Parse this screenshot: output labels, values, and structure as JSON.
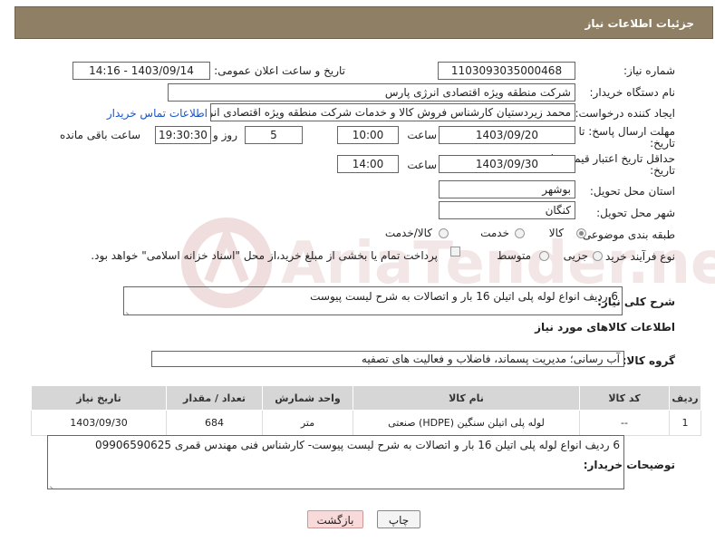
{
  "header": {
    "title": "جزئیات اطلاعات نیاز"
  },
  "form": {
    "need_number_label": "شماره نیاز:",
    "need_number": "1103093035000468",
    "announce_label": "تاریخ و ساعت اعلان عمومی:",
    "announce_value": "1403/09/14 - 14:16",
    "buyer_label": "نام دستگاه خریدار:",
    "buyer_value": "شرکت منطقه ویژه اقتصادی انرژی پارس",
    "creator_label": "ایجاد کننده درخواست:",
    "creator_value": "محمد زیردستیان کارشناس فروش کالا و خدمات شرکت منطقه ویژه اقتصادی انرژی",
    "contact_link": "اطلاعات تماس خریدار",
    "deadline_label_1": "مهلت ارسال پاسخ: تا",
    "deadline_label_2": "تاریخ:",
    "deadline_date": "1403/09/20",
    "time_label": "ساعت",
    "deadline_time": "10:00",
    "days_value": "5",
    "days_label": "روز و",
    "remaining_time": "19:30:30",
    "remaining_label": "ساعت باقی مانده",
    "validity_label_1": "حداقل تاریخ اعتبار قیمت: تا",
    "validity_label_2": "تاریخ:",
    "validity_date": "1403/09/30",
    "validity_time": "14:00",
    "province_label": "استان محل تحویل:",
    "province_value": "بوشهر",
    "city_label": "شهر محل تحویل:",
    "city_value": "کنگان",
    "category_label": "طبقه بندی موضوعی:",
    "category_options": [
      "کالا",
      "خدمت",
      "کالا/خدمت"
    ],
    "category_selected": "کالا",
    "process_label": "نوع فرآیند خرید :",
    "process_options": [
      "جزیی",
      "متوسط"
    ],
    "payment_note": "پرداخت تمام یا بخشی از مبلغ خرید،از محل \"اسناد خزانه اسلامی\" خواهد بود."
  },
  "description": {
    "label": "شرح کلی نیاز:",
    "value": "6 ردیف انواع لوله پلی اتیلن 16 بار و اتصالات به شرح لیست پیوست"
  },
  "goods": {
    "section_title": "اطلاعات کالاهای مورد نیاز",
    "group_label": "گروه کالا:",
    "group_value": "آب رسانی؛ مدیریت پسماند، فاضلاب و فعالیت های تصفیه",
    "columns": [
      "ردیف",
      "کد کالا",
      "نام کالا",
      "واحد شمارش",
      "تعداد / مقدار",
      "تاریخ نیاز"
    ],
    "rows": [
      [
        "1",
        "--",
        "لوله پلی اتیلن سنگین (HDPE) صنعتی",
        "متر",
        "684",
        "1403/09/30"
      ]
    ]
  },
  "buyer_notes": {
    "label": "توضیحات خریدار:",
    "value": "6 ردیف انواع لوله پلی اتیلن 16 بار و اتصالات به شرح لیست پیوست- کارشناس فنی مهندس قمری 09906590625"
  },
  "buttons": {
    "print": "چاپ",
    "back": "بازگشت"
  },
  "watermark": {
    "text": "AriaTender.net"
  },
  "colors": {
    "header_bg": "#8f7f64",
    "link": "#1a56c9",
    "back_button": "#f9dada"
  }
}
